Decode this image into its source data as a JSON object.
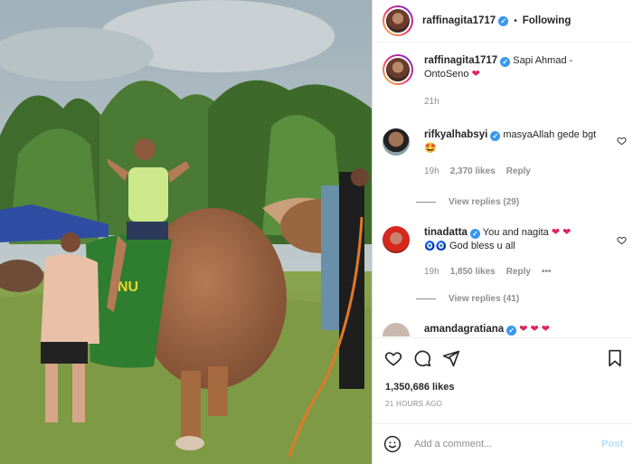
{
  "header": {
    "username": "raffinagita1717",
    "follow_state": "Following",
    "separator": "•"
  },
  "caption": {
    "username": "raffinagita1717",
    "text": "Sapi Ahmad - OntoSeno",
    "emoji": "❤",
    "time": "21h"
  },
  "comments": [
    {
      "username": "rifkyalhabsyi",
      "text": "masyaAllah gede bgt",
      "emoji": "🤩",
      "time": "19h",
      "likes": "2,370 likes",
      "reply": "Reply",
      "view_replies": "View replies (29)"
    },
    {
      "username": "tinadatta",
      "text": "You and nagita",
      "emoji": "❤ ❤",
      "line2_emoji": "🧿🧿",
      "line2_text": "God bless u all",
      "time": "19h",
      "likes": "1,850 likes",
      "reply": "Reply",
      "more": "•••",
      "view_replies": "View replies (41)"
    },
    {
      "username": "amandagratiana",
      "emoji": "❤ ❤ ❤"
    }
  ],
  "post": {
    "likes": "1,350,686 likes",
    "time_ago": "21 HOURS AGO"
  },
  "add_comment": {
    "placeholder": "Add a comment...",
    "post_label": "Post"
  },
  "photo": {
    "shirt_text": "NU"
  },
  "colors": {
    "verified": "#3897f0",
    "post_disabled": "#b2dffc",
    "heart": "#e0245e"
  }
}
